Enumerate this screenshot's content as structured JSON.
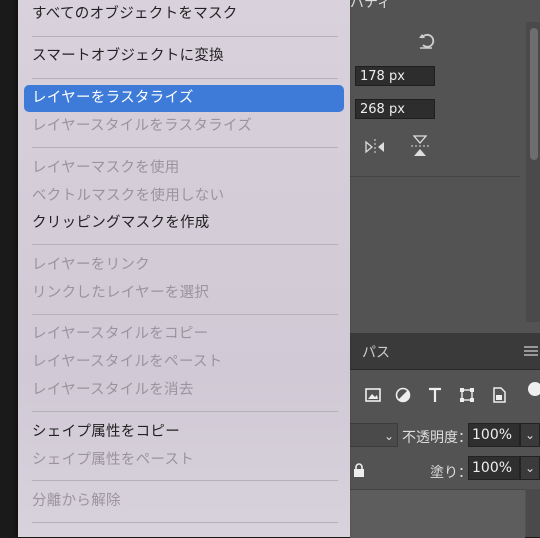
{
  "properties_panel": {
    "title_fragment": "パティ",
    "width_value": "178 px",
    "height_value": "268 px"
  },
  "layers_panel": {
    "tab_label": "パス",
    "opacity_label": "不透明度：",
    "opacity_value": "100%",
    "fill_label": "塗り：",
    "fill_value": "100%"
  },
  "context_menu": {
    "items": [
      {
        "label": "すべてのオブジェクトをマスク",
        "enabled": true
      },
      {
        "label": "スマートオブジェクトに変換",
        "enabled": true
      },
      {
        "label": "レイヤーをラスタライズ",
        "enabled": true,
        "selected": true
      },
      {
        "label": "レイヤースタイルをラスタライズ",
        "enabled": false
      },
      {
        "label": "レイヤーマスクを使用",
        "enabled": false
      },
      {
        "label": "ベクトルマスクを使用しない",
        "enabled": false
      },
      {
        "label": "クリッピングマスクを作成",
        "enabled": true
      },
      {
        "label": "レイヤーをリンク",
        "enabled": false
      },
      {
        "label": "リンクしたレイヤーを選択",
        "enabled": false
      },
      {
        "label": "レイヤースタイルをコピー",
        "enabled": false
      },
      {
        "label": "レイヤースタイルをペースト",
        "enabled": false
      },
      {
        "label": "レイヤースタイルを消去",
        "enabled": false
      },
      {
        "label": "シェイプ属性をコピー",
        "enabled": true
      },
      {
        "label": "シェイプ属性をペースト",
        "enabled": false
      },
      {
        "label": "分離から解除",
        "enabled": false
      }
    ],
    "highlight_color": "#3e7bd9"
  }
}
